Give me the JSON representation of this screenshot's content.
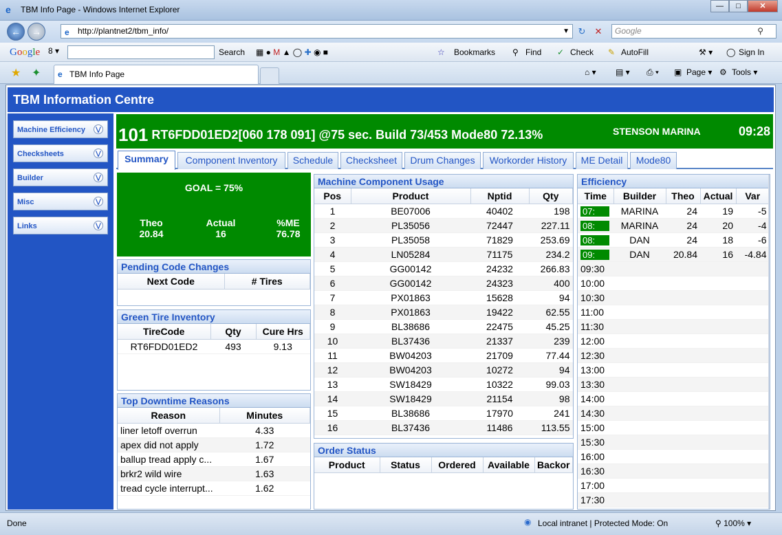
{
  "window": {
    "title": "TBM Info Page - Windows Internet Explorer",
    "url": "http://plantnet2/tbm_info/",
    "search_placeholder": "Google",
    "tab_label": "TBM Info Page",
    "status_left": "Done",
    "status_zone": "Local intranet | Protected Mode: On",
    "zoom": "100%"
  },
  "googlebar": {
    "search_label": "Search",
    "bookmarks": "Bookmarks",
    "find": "Find",
    "check": "Check",
    "autofill": "AutoFill",
    "sign_in": "Sign In"
  },
  "commandbar": {
    "page": "Page",
    "tools": "Tools"
  },
  "app": {
    "header": "TBM Information Centre",
    "sidebar": [
      "Machine Efficiency",
      "Checksheets",
      "Builder",
      "Misc",
      "Links"
    ],
    "status_line": {
      "machine": "101",
      "detail": "RT6FDD01ED2[060 178 091] @75 sec. Build 73/453 Mode80 72.13%",
      "builder": "STENSON MARINA",
      "time": "09:28"
    },
    "tabs": [
      "Summary",
      "Component Inventory",
      "Schedule",
      "Checksheet",
      "Drum Changes",
      "Workorder History",
      "ME Detail",
      "Mode80"
    ],
    "active_tab": "Summary"
  },
  "goal": {
    "title": "GOAL = 75%",
    "theo_label": "Theo",
    "theo_value": "20.84",
    "actual_label": "Actual",
    "actual_value": "16",
    "me_label": "%ME",
    "me_value": "76.78"
  },
  "pending": {
    "title": "Pending Code Changes",
    "columns": [
      "Next Code",
      "# Tires"
    ]
  },
  "green_tire": {
    "title": "Green Tire Inventory",
    "columns": [
      "TireCode",
      "Qty",
      "Cure Hrs"
    ],
    "rows": [
      [
        "RT6FDD01ED2",
        "493",
        "9.13"
      ]
    ]
  },
  "downtime": {
    "title": "Top Downtime Reasons",
    "columns": [
      "Reason",
      "Minutes"
    ],
    "rows": [
      [
        "liner letoff overrun",
        "4.33"
      ],
      [
        "apex did not apply",
        "1.72"
      ],
      [
        "ballup tread apply c...",
        "1.67"
      ],
      [
        "brkr2 wild wire",
        "1.63"
      ],
      [
        "tread cycle interrupt...",
        "1.62"
      ]
    ]
  },
  "components": {
    "title": "Machine Component Usage",
    "columns": [
      "Pos",
      "Product",
      "Nptid",
      "Qty"
    ],
    "rows": [
      [
        "1",
        "BE07006",
        "40402",
        "198"
      ],
      [
        "2",
        "PL35056",
        "72447",
        "227.11"
      ],
      [
        "3",
        "PL35058",
        "71829",
        "253.69"
      ],
      [
        "4",
        "LN05284",
        "71175",
        "234.2"
      ],
      [
        "5",
        "GG00142",
        "24232",
        "266.83"
      ],
      [
        "6",
        "GG00142",
        "24323",
        "400"
      ],
      [
        "7",
        "PX01863",
        "15628",
        "94"
      ],
      [
        "8",
        "PX01863",
        "19422",
        "62.55"
      ],
      [
        "9",
        "BL38686",
        "22475",
        "45.25"
      ],
      [
        "10",
        "BL37436",
        "21337",
        "239"
      ],
      [
        "11",
        "BW04203",
        "21709",
        "77.44"
      ],
      [
        "12",
        "BW04203",
        "10272",
        "94"
      ],
      [
        "13",
        "SW18429",
        "10322",
        "99.03"
      ],
      [
        "14",
        "SW18429",
        "21154",
        "98"
      ],
      [
        "15",
        "BL38686",
        "17970",
        "241"
      ],
      [
        "16",
        "BL37436",
        "11486",
        "113.55"
      ]
    ]
  },
  "order_status": {
    "title": "Order Status",
    "columns": [
      "Product",
      "Status",
      "Ordered",
      "Available",
      "Backor"
    ]
  },
  "efficiency": {
    "title": "Efficiency",
    "columns": [
      "Time",
      "Builder",
      "Theo",
      "Actual",
      "Var"
    ],
    "rows": [
      [
        "07:",
        "MARINA",
        "24",
        "19",
        "-5"
      ],
      [
        "08:",
        "MARINA",
        "24",
        "20",
        "-4"
      ],
      [
        "08:",
        "DAN",
        "24",
        "18",
        "-6"
      ],
      [
        "09:",
        "DAN",
        "20.84",
        "16",
        "-4.84"
      ]
    ],
    "empty_times": [
      "09:30",
      "10:00",
      "10:30",
      "11:00",
      "11:30",
      "12:00",
      "12:30",
      "13:00",
      "13:30",
      "14:00",
      "14:30",
      "15:00",
      "15:30",
      "16:00",
      "16:30",
      "17:00",
      "17:30"
    ]
  }
}
